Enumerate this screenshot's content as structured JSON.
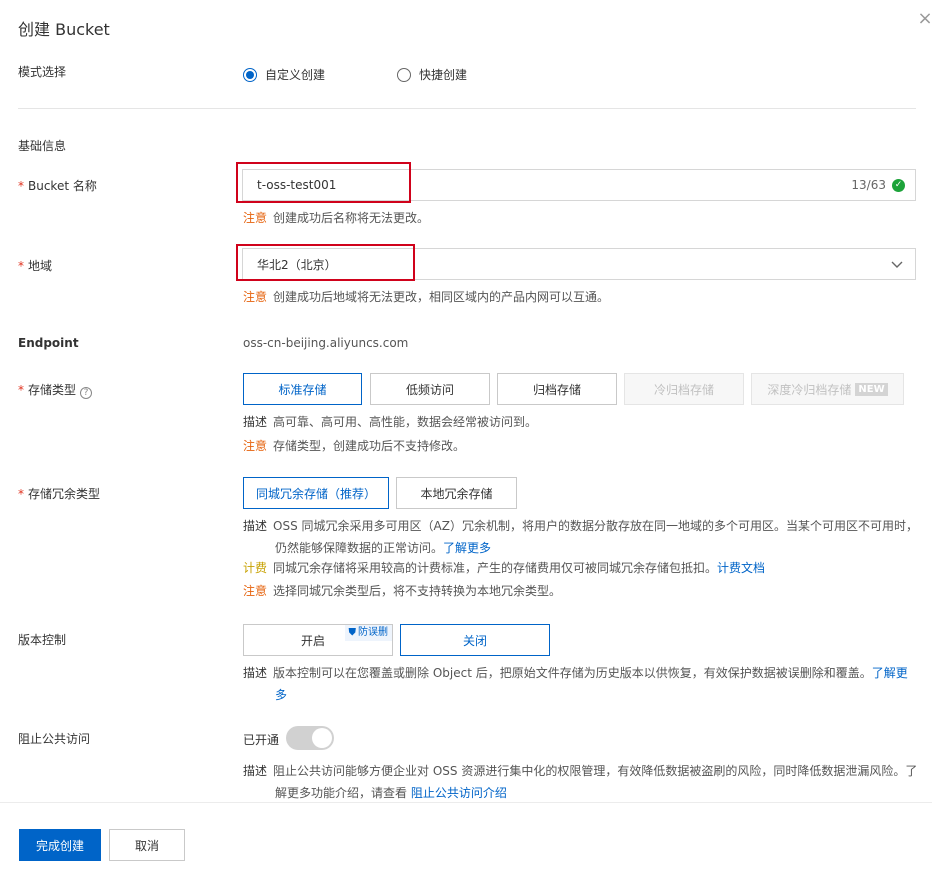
{
  "dialog": {
    "title": "创建 Bucket",
    "close_icon": "×"
  },
  "mode": {
    "label": "模式选择",
    "options": [
      {
        "label": "自定义创建",
        "selected": true
      },
      {
        "label": "快捷创建",
        "selected": false
      }
    ]
  },
  "basic": {
    "section_label": "基础信息"
  },
  "bucket_name": {
    "label": "Bucket 名称",
    "value": "t-oss-test001",
    "counter": "13/63",
    "note_tag": "注意",
    "note_text": "创建成功后名称将无法更改。"
  },
  "region": {
    "label": "地域",
    "value": "华北2（北京）",
    "note_tag": "注意",
    "note_text": "创建成功后地域将无法更改，相同区域内的产品内网可以互通。"
  },
  "endpoint": {
    "label": "Endpoint",
    "value": "oss-cn-beijing.aliyuncs.com"
  },
  "storage_class": {
    "label": "存储类型",
    "help_icon": "?",
    "options": [
      {
        "label": "标准存储",
        "state": "active"
      },
      {
        "label": "低频访问",
        "state": "normal"
      },
      {
        "label": "归档存储",
        "state": "normal"
      },
      {
        "label": "冷归档存储",
        "state": "disabled"
      },
      {
        "label": "深度冷归档存储",
        "state": "disabled",
        "badge": "NEW"
      }
    ],
    "desc_tag": "描述",
    "desc_text": "高可靠、高可用、高性能，数据会经常被访问到。",
    "note_tag": "注意",
    "note_text": "存储类型，创建成功后不支持修改。"
  },
  "redundancy": {
    "label": "存储冗余类型",
    "options": [
      {
        "label": "同城冗余存储（推荐）",
        "state": "active"
      },
      {
        "label": "本地冗余存储",
        "state": "normal"
      }
    ],
    "desc_tag": "描述",
    "desc_line1": "OSS 同城冗余采用多可用区（AZ）冗余机制，将用户的数据分散存放在同一地域的多个可用区。当某个可用区不可用时，",
    "desc_line2": "仍然能够保障数据的正常访问。",
    "desc_link": "了解更多",
    "fee_tag": "计费",
    "fee_text": "同城冗余存储将采用较高的计费标准，产生的存储费用仅可被同城冗余存储包抵扣。",
    "fee_link": "计费文档",
    "note_tag": "注意",
    "note_text": "选择同城冗余类型后，将不支持转换为本地冗余类型。"
  },
  "versioning": {
    "label": "版本控制",
    "on_label": "开启",
    "badge": "防误删",
    "off_label": "关闭",
    "desc_tag": "描述",
    "desc_line1": "版本控制可以在您覆盖或删除 Object 后，把原始文件存储为历史版本以供恢复，有效保护数据被误删除和覆盖。",
    "desc_link1": "了解更",
    "desc_link2": "多"
  },
  "public_block": {
    "label": "阻止公共访问",
    "status": "已开通",
    "enabled": true,
    "desc_tag": "描述",
    "desc_line1": "阻止公共访问能够方便企业对 OSS 资源进行集中化的权限管理，有效降低数据被盗刷的风险，同时降低数据泄漏风险。了",
    "desc_line2": "解更多功能介绍，请查看",
    "desc_link": "阻止公共访问介绍"
  },
  "footer": {
    "confirm_label": "完成创建",
    "cancel_label": "取消"
  },
  "colors": {
    "primary": "#0064c8",
    "warning": "#e6630e",
    "required": "#e0321f",
    "highlight_box": "#d0021b"
  }
}
